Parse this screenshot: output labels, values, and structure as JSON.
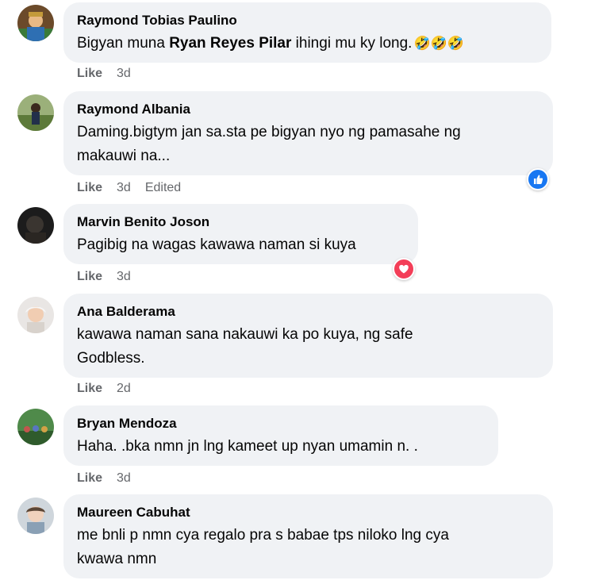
{
  "comments": [
    {
      "author": "Raymond Tobias Paulino",
      "text_before": "Bigyan muna ",
      "mention": "Ryan Reyes Pilar",
      "text_after": " ihingi mu ky long.",
      "emojis": "🤣🤣🤣",
      "like_label": "Like",
      "time": "3d"
    },
    {
      "author": "Raymond Albania",
      "text": "Daming.bigtym jan sa.sta pe bigyan nyo ng pamasahe ng\nmakauwi na...",
      "like_label": "Like",
      "time": "3d",
      "edited": "Edited",
      "reaction": "like-reaction-icon"
    },
    {
      "author": "Marvin Benito Joson",
      "text": "Pagibig na wagas kawawa naman si kuya",
      "like_label": "Like",
      "time": "3d",
      "reaction": "love-reaction-icon"
    },
    {
      "author": "Ana Balderama",
      "text": "kawawa naman sana nakauwi ka po kuya, ng safe\nGodbless.",
      "like_label": "Like",
      "time": "2d"
    },
    {
      "author": "Bryan Mendoza",
      "text": "Haha. .bka nmn jn lng kameet up nyan umamin n. .",
      "like_label": "Like",
      "time": "3d"
    },
    {
      "author": "Maureen Cabuhat",
      "text": "me bnli p nmn cya regalo pra s babae tps niloko lng cya\nkwawa nmn"
    }
  ],
  "colors": {
    "bubble_bg": "#f0f2f5",
    "meta_text": "#65676b",
    "like_blue": "#1877f2",
    "love_red": "#f33e58"
  }
}
